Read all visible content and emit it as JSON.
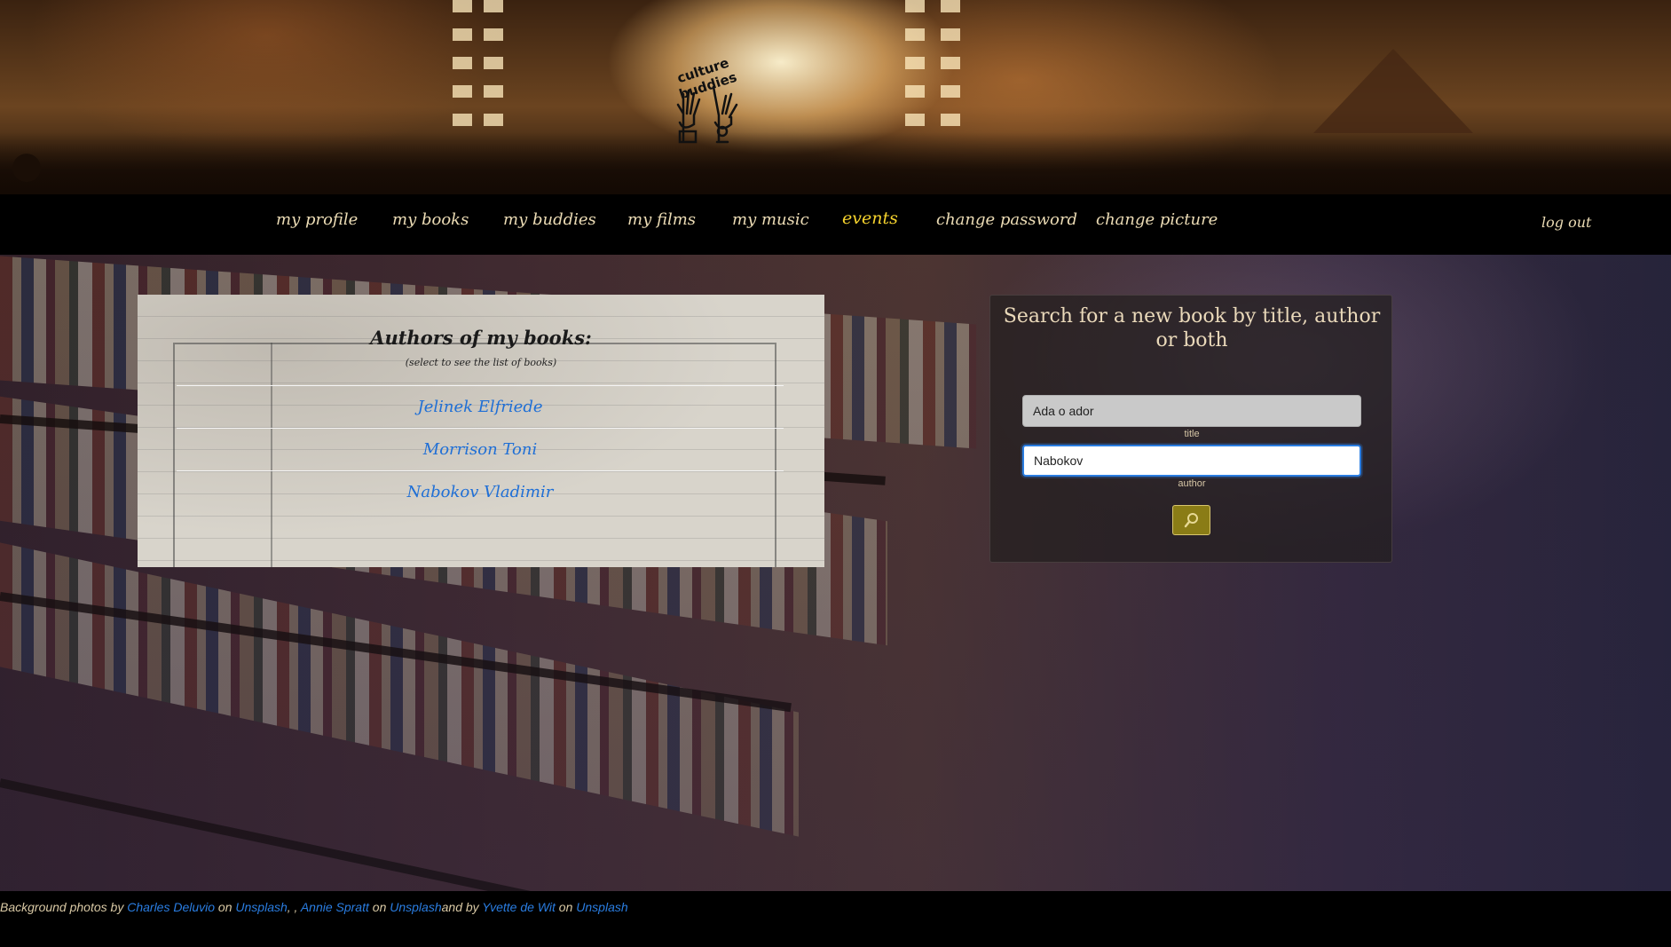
{
  "header": {
    "logo_text": "culture buddies"
  },
  "nav": {
    "items": [
      {
        "label": "my profile"
      },
      {
        "label": "my books"
      },
      {
        "label": "my buddies"
      },
      {
        "label": "my films"
      },
      {
        "label": "my music"
      },
      {
        "label": "events"
      },
      {
        "label": "change password"
      },
      {
        "label": "change picture"
      }
    ],
    "logout_label": "log out",
    "active_item": "events"
  },
  "authors": {
    "title": "Authors of my books:",
    "subtitle": "(select to see the list of books)",
    "list": [
      {
        "name": "Jelinek Elfriede"
      },
      {
        "name": "Morrison Toni"
      },
      {
        "name": "Nabokov Vladimir"
      }
    ]
  },
  "search": {
    "title": "Search for a new book by title, author or both",
    "title_value": "Ada o ador",
    "title_label": "title",
    "author_value": "Nabokov",
    "author_label": "author",
    "button_icon": "magnifier-icon"
  },
  "footer": {
    "prefix": "Background photos by ",
    "credit1_name": "Charles Deluvio",
    "on1": " on ",
    "site1": "Unsplash",
    "sep": ", , ",
    "credit2_name": "Annie Spratt",
    "on2": " on ",
    "site2": "Unsplash",
    "and_by": "and by ",
    "credit3_name": "Yvette de Wit",
    "on3": " on ",
    "site3": "Unsplash"
  },
  "colors": {
    "nav_text": "#ecdcb5",
    "nav_active": "#f5d22d",
    "link_blue": "#1f6fd6",
    "button_olive": "#8a7c16"
  }
}
